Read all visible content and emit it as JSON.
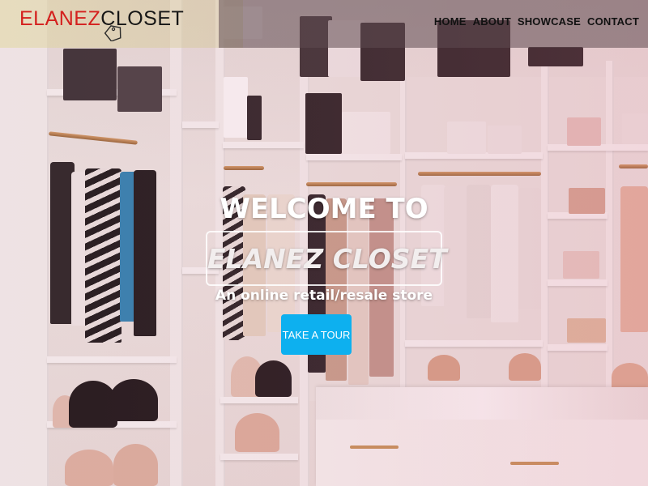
{
  "header": {
    "logo": {
      "part1": "ELANEZ",
      "part2": "CLOSET"
    },
    "nav": [
      {
        "label": "HOME"
      },
      {
        "label": "ABOUT"
      },
      {
        "label": "SHOWCASE"
      },
      {
        "label": "CONTACT"
      }
    ]
  },
  "hero": {
    "title": "WELCOME TO",
    "store_name": "ELANEZ CLOSET",
    "tagline": "An online retail/resale store",
    "cta_label": "TAKE A TOUR"
  },
  "colors": {
    "logo_red": "#d4201e",
    "logo_dark": "#161616",
    "cta_blue": "#0db0ef",
    "overlay_tint": "#c8607f"
  }
}
